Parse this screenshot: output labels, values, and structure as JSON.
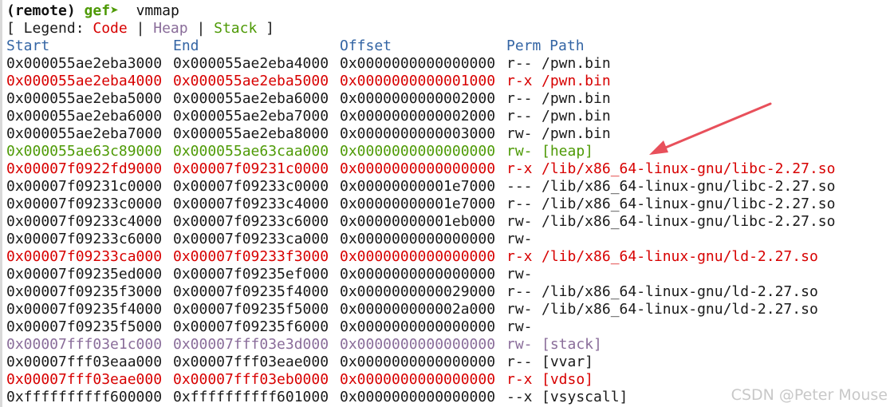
{
  "prompt": {
    "remote": "(remote)",
    "gef": "gef",
    "arrow": "➤",
    "command": "vmmap"
  },
  "legend": {
    "open": "[ Legend: ",
    "code": "Code",
    "sep1": " | ",
    "heap": "Heap",
    "sep2": " | ",
    "stack": "Stack",
    "close": " ]"
  },
  "headers": {
    "start": "Start",
    "end": "End",
    "offset": "Offset",
    "perm_path": "Perm Path"
  },
  "rows": [
    {
      "start": "0x000055ae2eba3000",
      "end": "0x000055ae2eba4000",
      "offset": "0x0000000000000000",
      "perm": "r--",
      "path": "/pwn.bin",
      "kind": "normal"
    },
    {
      "start": "0x000055ae2eba4000",
      "end": "0x000055ae2eba5000",
      "offset": "0x0000000000001000",
      "perm": "r-x",
      "path": "/pwn.bin",
      "kind": "code"
    },
    {
      "start": "0x000055ae2eba5000",
      "end": "0x000055ae2eba6000",
      "offset": "0x0000000000002000",
      "perm": "r--",
      "path": "/pwn.bin",
      "kind": "normal"
    },
    {
      "start": "0x000055ae2eba6000",
      "end": "0x000055ae2eba7000",
      "offset": "0x0000000000002000",
      "perm": "r--",
      "path": "/pwn.bin",
      "kind": "normal"
    },
    {
      "start": "0x000055ae2eba7000",
      "end": "0x000055ae2eba8000",
      "offset": "0x0000000000003000",
      "perm": "rw-",
      "path": "/pwn.bin",
      "kind": "normal"
    },
    {
      "start": "0x000055ae63c89000",
      "end": "0x000055ae63caa000",
      "offset": "0x0000000000000000",
      "perm": "rw-",
      "path": "[heap]",
      "kind": "heap"
    },
    {
      "start": "0x00007f0922fd9000",
      "end": "0x00007f09231c0000",
      "offset": "0x0000000000000000",
      "perm": "r-x",
      "path": "/lib/x86_64-linux-gnu/libc-2.27.so",
      "kind": "code"
    },
    {
      "start": "0x00007f09231c0000",
      "end": "0x00007f09233c0000",
      "offset": "0x00000000001e7000",
      "perm": "---",
      "path": "/lib/x86_64-linux-gnu/libc-2.27.so",
      "kind": "normal"
    },
    {
      "start": "0x00007f09233c0000",
      "end": "0x00007f09233c4000",
      "offset": "0x00000000001e7000",
      "perm": "r--",
      "path": "/lib/x86_64-linux-gnu/libc-2.27.so",
      "kind": "normal"
    },
    {
      "start": "0x00007f09233c4000",
      "end": "0x00007f09233c6000",
      "offset": "0x00000000001eb000",
      "perm": "rw-",
      "path": "/lib/x86_64-linux-gnu/libc-2.27.so",
      "kind": "normal"
    },
    {
      "start": "0x00007f09233c6000",
      "end": "0x00007f09233ca000",
      "offset": "0x0000000000000000",
      "perm": "rw-",
      "path": "",
      "kind": "normal"
    },
    {
      "start": "0x00007f09233ca000",
      "end": "0x00007f09233f3000",
      "offset": "0x0000000000000000",
      "perm": "r-x",
      "path": "/lib/x86_64-linux-gnu/ld-2.27.so",
      "kind": "code"
    },
    {
      "start": "0x00007f09235ed000",
      "end": "0x00007f09235ef000",
      "offset": "0x0000000000000000",
      "perm": "rw-",
      "path": "",
      "kind": "normal"
    },
    {
      "start": "0x00007f09235f3000",
      "end": "0x00007f09235f4000",
      "offset": "0x0000000000029000",
      "perm": "r--",
      "path": "/lib/x86_64-linux-gnu/ld-2.27.so",
      "kind": "normal"
    },
    {
      "start": "0x00007f09235f4000",
      "end": "0x00007f09235f5000",
      "offset": "0x000000000002a000",
      "perm": "rw-",
      "path": "/lib/x86_64-linux-gnu/ld-2.27.so",
      "kind": "normal"
    },
    {
      "start": "0x00007f09235f5000",
      "end": "0x00007f09235f6000",
      "offset": "0x0000000000000000",
      "perm": "rw-",
      "path": "",
      "kind": "normal"
    },
    {
      "start": "0x00007fff03e1c000",
      "end": "0x00007fff03e3d000",
      "offset": "0x0000000000000000",
      "perm": "rw-",
      "path": "[stack]",
      "kind": "stack"
    },
    {
      "start": "0x00007fff03eaa000",
      "end": "0x00007fff03eae000",
      "offset": "0x0000000000000000",
      "perm": "r--",
      "path": "[vvar]",
      "kind": "normal"
    },
    {
      "start": "0x00007fff03eae000",
      "end": "0x00007fff03eb0000",
      "offset": "0x0000000000000000",
      "perm": "r-x",
      "path": "[vdso]",
      "kind": "code"
    },
    {
      "start": "0xffffffffff600000",
      "end": "0xffffffffff601000",
      "offset": "0x0000000000000000",
      "perm": "--x",
      "path": "[vsyscall]",
      "kind": "normal"
    }
  ],
  "colors": {
    "code": "#d70000",
    "heap": "#4e9a06",
    "stack": "#8a6d9a",
    "header": "#3465a4",
    "annotation_arrow": "#e8505b"
  },
  "annotation": {
    "icon": "annotation-arrow-icon"
  },
  "watermark": "CSDN @Peter Mouse"
}
